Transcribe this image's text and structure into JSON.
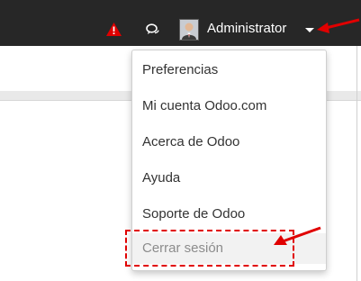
{
  "navbar": {
    "alert_icon": "warning-icon",
    "chat_icon": "chat-bubbles-icon",
    "user_name": "Administrator",
    "caret_icon": "caret-down-icon",
    "background_color": "#272727",
    "alert_color": "#e00000"
  },
  "user_menu": {
    "items": [
      {
        "label": "Preferencias"
      },
      {
        "label": "Mi cuenta Odoo.com"
      },
      {
        "label": "Acerca de Odoo"
      },
      {
        "label": "Ayuda"
      },
      {
        "label": "Soporte de Odoo"
      },
      {
        "label": "Cerrar sesión"
      }
    ]
  },
  "annotation": {
    "color": "#e00000",
    "arrow_icon": "red-arrow-icon",
    "highlight_box": "dashed-red-rectangle"
  }
}
